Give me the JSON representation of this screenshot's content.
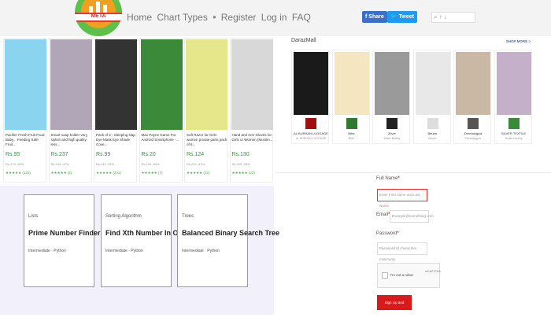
{
  "header": {
    "logo_text": "META",
    "nav": [
      "Home",
      "Chart Types",
      "Register",
      "Log in",
      "FAQ"
    ],
    "share_label": "Share",
    "tweet_label": "Tweet"
  },
  "products": [
    {
      "name": "Pacifier Fresh Fruit Food Baby... Feeding Safe Fruit...",
      "price": "Rs.95",
      "old": "Rs.179 -48%",
      "rating": "★★★★★ (130)",
      "color": "#8bd4ef"
    },
    {
      "name": "Smart soap holder very stylish and high quality less...",
      "price": "Rs.237",
      "old": "Rs.449 -47%",
      "rating": "★★★★★ (6)",
      "color": "#b0a6b8"
    },
    {
      "name": "Pack of 2 - Sleeping Nap Eye Mask Eye Shade Cove...",
      "price": "Rs.99",
      "old": "Rs.149 -34%",
      "rating": "★★★★★ (231)",
      "color": "#333333"
    },
    {
      "name": "Max Payne Game For Android Smartphone -...",
      "price": "Rs.20",
      "old": "Rs.100 -80%",
      "rating": "★★★★★ (7)",
      "color": "#3b8a3a"
    },
    {
      "name": "Soft Razor for Girls women private parts pack of 6...",
      "price": "Rs.124",
      "old": "Rs.212 -41%",
      "rating": "★★★★★ (22)",
      "color": "#e6e68a"
    },
    {
      "name": "Hand and Arm Gloves for Girls or Women (Muslim...",
      "price": "Rs.130",
      "old": "Rs.200 -35%",
      "rating": "★★★★★ (22)",
      "color": "#d8d8d8"
    }
  ],
  "cards": [
    {
      "category": "Lists",
      "title": "Prime Number Finder",
      "level": "Intermediate · Python"
    },
    {
      "category": "Sorting Algorithm",
      "title": "Find Xth Number In Order",
      "level": "Intermediate · Python"
    },
    {
      "category": "Trees",
      "title": "Balanced Binary Search Tree",
      "level": "Intermediate · Python"
    }
  ],
  "mall": {
    "title": "DarazMall",
    "shop_more": "SHOP MORE >",
    "items": [
      {
        "name": "AL BURHAN LUGGAGE",
        "sub": "AL BURHAN LUGGAGE",
        "color": "#1a1a1a",
        "badge": "#a01010"
      },
      {
        "name": "Brite",
        "sub": "Brite",
        "color": "#f4e6c0",
        "badge": "#2e7a2e"
      },
      {
        "name": "Zilver",
        "sub": "Water Bottles",
        "color": "#9a9a9a",
        "badge": "#222222"
      },
      {
        "name": "Beurer",
        "sub": "Beurer",
        "color": "#e8e8e8",
        "badge": "#dddddd"
      },
      {
        "name": "Dermalogica",
        "sub": "Dermalogica",
        "color": "#c9b8a4",
        "badge": "#555555"
      },
      {
        "name": "SILVER TEXTILE",
        "sub": "Textile Factory",
        "color": "#c4b0c8",
        "badge": "#3a8a3a"
      }
    ]
  },
  "form": {
    "fullname_label": "Full Name",
    "fullname_placeholder": "Enter First name and Last Name",
    "email_label": "Email",
    "email_placeholder": "Example@something.com",
    "password_label": "Password",
    "password_placeholder": "Password (8 characters minimum)",
    "captcha_label": "I'm not a robot",
    "captcha_brand": "reCAPTCHA",
    "signup_label": "Sign Up and Continue"
  }
}
